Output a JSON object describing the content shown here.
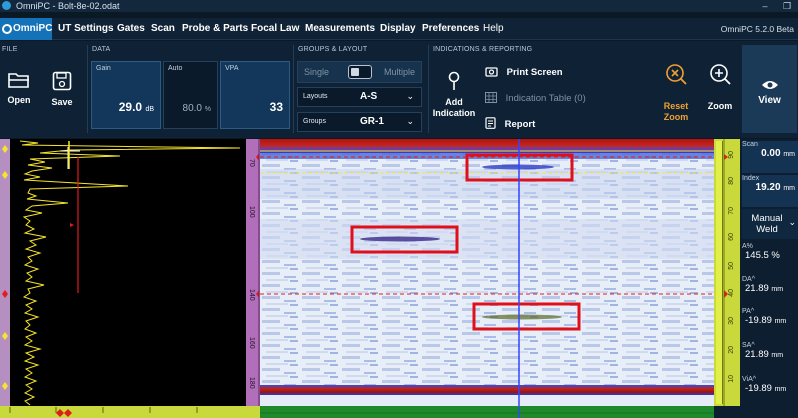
{
  "titlebar": {
    "title": "OmniPC - Bolt-8e-02.odat",
    "minimize": "–",
    "restore": "❐"
  },
  "menu": {
    "brand": "OmniPC",
    "items": [
      "UT Settings",
      "Gates",
      "Scan",
      "Probe & Parts",
      "Focal Law",
      "Measurements",
      "Display",
      "Preferences",
      "Help"
    ],
    "version": "OmniPC 5.2.0 Beta"
  },
  "ribbon": {
    "file": {
      "label": "FILE",
      "open": "Open",
      "save": "Save"
    },
    "data": {
      "label": "DATA",
      "gain": {
        "label": "Gain",
        "value": "29.0",
        "unit": "dB"
      },
      "auto": {
        "label": "Auto",
        "value": "80.0",
        "unit": "%"
      },
      "vpa": {
        "label": "VPA",
        "value": "33"
      }
    },
    "groups_layout": {
      "label": "GROUPS & LAYOUT",
      "single": "Single",
      "multiple": "Multiple",
      "layouts": {
        "label": "Layouts",
        "value": "A-S"
      },
      "groups": {
        "label": "Groups",
        "value": "GR-1"
      }
    },
    "indications": {
      "label": "INDICATIONS & REPORTING",
      "add": "Add Indication",
      "print": "Print Screen",
      "table": "Indication Table (0)",
      "report": "Report"
    },
    "reset_zoom": "Reset Zoom",
    "zoom": "Zoom",
    "view": "View"
  },
  "colors": {
    "accent": "#1473b8",
    "reset": "#f0a030",
    "ruler": "#c9d83a",
    "highlight_box": "#e0101a",
    "cursor": "#3344ff"
  },
  "depth_labels": [
    "70",
    "100",
    "140",
    "160",
    "170",
    "180"
  ],
  "right_ruler_labels": [
    "90",
    "80",
    "70",
    "60",
    "50",
    "40",
    "30",
    "20",
    "10"
  ],
  "readouts": {
    "scan": {
      "label": "Scan",
      "value": "0.00",
      "unit": "mm"
    },
    "index": {
      "label": "Index",
      "value": "19.20",
      "unit": "mm"
    },
    "mode": {
      "value": "Manual Weld"
    },
    "a_pct": {
      "label": "A%",
      "value": "145.5 %"
    },
    "da": {
      "label": "DA^",
      "value": "21.89",
      "unit": "mm"
    },
    "pa": {
      "label": "PA^",
      "value": "-19.89",
      "unit": "mm"
    },
    "sa": {
      "label": "SA^",
      "value": "21.89",
      "unit": "mm"
    },
    "via": {
      "label": "ViA^",
      "value": "-19.89",
      "unit": "mm"
    }
  }
}
